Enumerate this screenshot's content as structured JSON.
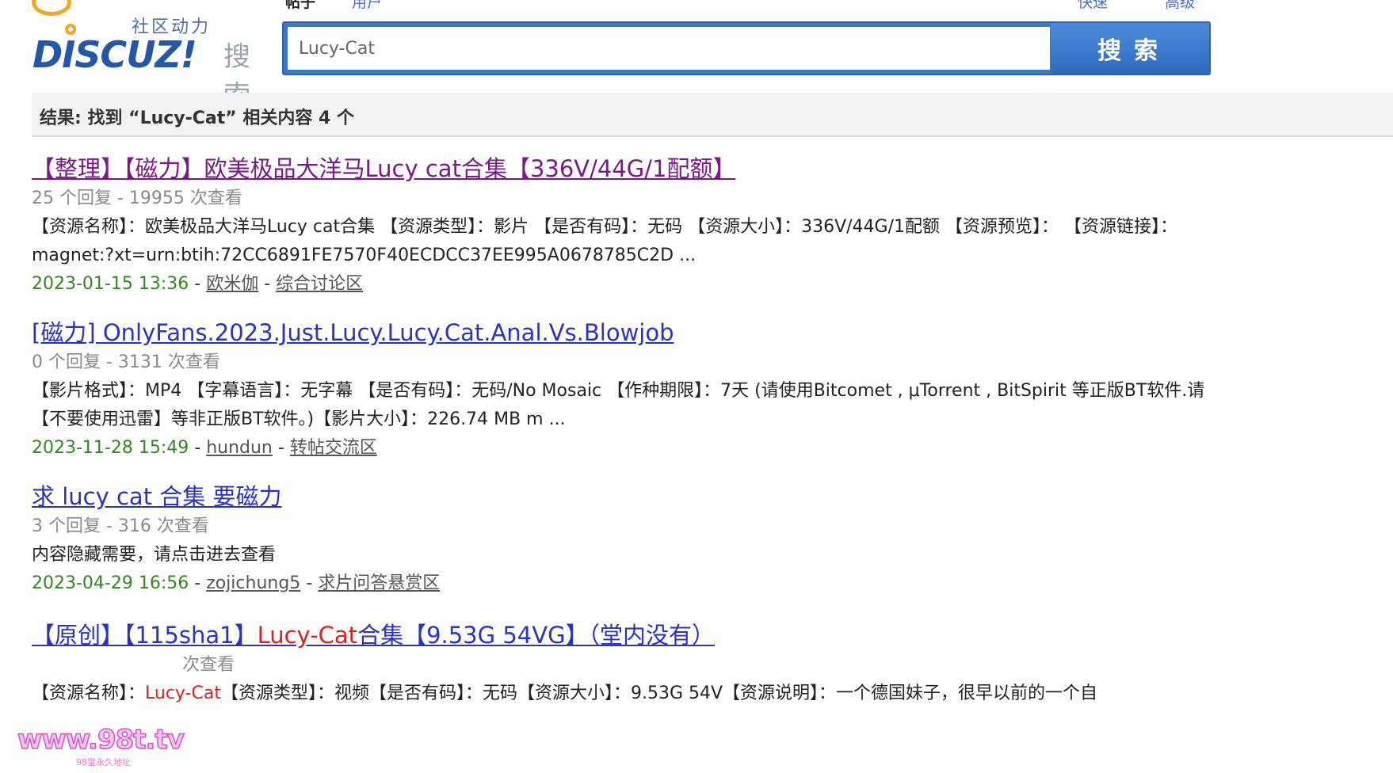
{
  "logo": {
    "slogan": "社区动力",
    "brand": "DISCUZ!",
    "search_word": "搜索"
  },
  "topnav": {
    "tab_posts": "帖子",
    "tab_users": "用户",
    "opt_fast": "快速",
    "opt_adv": "高级"
  },
  "search": {
    "value": "Lucy-Cat",
    "button_label": "搜索"
  },
  "results_summary": "结果: 找到 “Lucy-Cat” 相关内容 4 个",
  "results": [
    {
      "title": "【整理】【磁力】欧美极品大洋马Lucy cat合集【336V/44G/1配额】",
      "meta": "25 个回复 - 19955 次查看",
      "desc": "【资源名称】：欧美极品大洋马Lucy cat合集 【资源类型】：影片 【是否有码】：无码 【资源大小】：336V/44G/1配额 【资源预览】：  【资源链接】：magnet:?xt=urn:btih:72CC6891FE7570F40ECDCC37EE995A0678785C2D ...",
      "date": "2023-01-15 13:36",
      "author": "欧米伽",
      "forum": "综合讨论区"
    },
    {
      "title": "[磁力] OnlyFans.2023.Just.Lucy.Lucy.Cat.Anal.Vs.Blowjob",
      "meta": "0 个回复 - 3131 次查看",
      "desc": "【影片格式】：MP4 【字幕语言】：无字幕 【是否有码】：无码/No Mosaic 【作种期限】：7天 (请使用Bitcomet , μTorrent , BitSpirit 等正版BT软件.请【不要使用迅雷】等非正版BT软件。)【影片大小】：226.74 MB m ...",
      "date": "2023-11-28 15:49",
      "author": "hundun",
      "forum": "转帖交流区"
    },
    {
      "title": "求 lucy cat 合集 要磁力",
      "meta": "3 个回复 - 316 次查看",
      "desc": "内容隐藏需要，请点击进去查看",
      "date": "2023-04-29 16:56",
      "author": "zojichung5",
      "forum": "求片问答悬赏区"
    },
    {
      "title_prefix": "【原创】【115sha1】",
      "title_highlight": "Lucy-Cat",
      "title_suffix": "合集【9.53G 54VG】（堂内没有）",
      "meta": "次查看",
      "desc_prefix": "【资源名称】：",
      "desc_highlight": "Lucy-Cat",
      "desc_suffix": "【资源类型】：视频【是否有码】：无码【资源大小】：9.53G 54V【资源说明】：一个德国妹子，很早以前的一个自"
    }
  ],
  "watermark": {
    "text": "www.98t.tv",
    "sub": "98堂永久地址"
  }
}
